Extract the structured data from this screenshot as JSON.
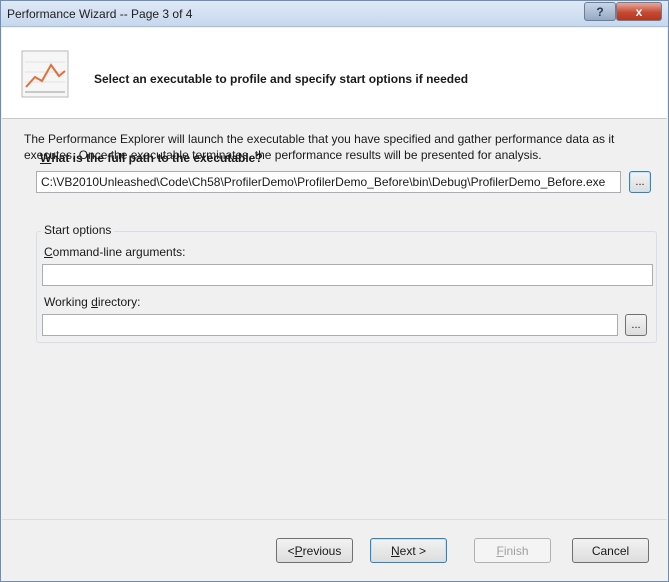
{
  "window": {
    "title": "Performance Wizard -- Page 3 of 4",
    "help_label": "?",
    "close_label": "x"
  },
  "header": {
    "title": "Select an executable to profile and specify start options if needed",
    "graphic_icon": "performance-chart-icon"
  },
  "main": {
    "description": "The Performance Explorer will launch the executable that you have specified and gather performance data as it executes.  Once the executable terminates, the performance results will be presented for analysis.",
    "path_label_key": "W",
    "path_label_rest": "hat is the full path to the executable?",
    "path_value": "C:\\VB2010Unleashed\\Code\\Ch58\\ProfilerDemo\\ProfilerDemo_Before\\bin\\Debug\\ProfilerDemo_Before.exe",
    "browse_label": "...",
    "start_options": {
      "legend": "Start options",
      "args_label_key": "C",
      "args_label_rest": "ommand-line arguments:",
      "args_value": "",
      "workdir_label_pre": "Working ",
      "workdir_label_key": "d",
      "workdir_label_rest": "irectory:",
      "workdir_value": "",
      "browse_label": "..."
    }
  },
  "footer": {
    "previous_prefix": "< ",
    "previous_key": "P",
    "previous_rest": "revious",
    "next_key": "N",
    "next_rest": "ext >",
    "finish_key": "F",
    "finish_rest": "inish",
    "cancel_label": "Cancel"
  },
  "colors": {
    "chart_line": "#e0703a",
    "title_bar": "#c7d8ee",
    "close_button": "#c64a32"
  }
}
